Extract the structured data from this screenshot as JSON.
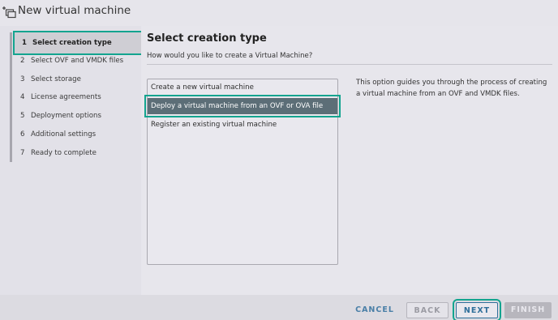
{
  "window": {
    "title": "New virtual machine",
    "icon": "new-vm-icon"
  },
  "sidebar": {
    "steps": [
      {
        "num": "1",
        "label": "Select creation type"
      },
      {
        "num": "2",
        "label": "Select OVF and VMDK files"
      },
      {
        "num": "3",
        "label": "Select storage"
      },
      {
        "num": "4",
        "label": "License agreements"
      },
      {
        "num": "5",
        "label": "Deployment options"
      },
      {
        "num": "6",
        "label": "Additional settings"
      },
      {
        "num": "7",
        "label": "Ready to complete"
      }
    ]
  },
  "main": {
    "heading": "Select creation type",
    "subheading": "How would you like to create a Virtual Machine?",
    "options": [
      {
        "label": "Create a new virtual machine"
      },
      {
        "label": "Deploy a virtual machine from an OVF or OVA file"
      },
      {
        "label": "Register an existing virtual machine"
      }
    ],
    "selected_option": "Deploy a virtual machine from an OVF or OVA file",
    "description": "This option guides you through the process of creating a virtual machine from an OVF and VMDK files."
  },
  "footer": {
    "cancel_label": "CANCEL",
    "back_label": "BACK",
    "next_label": "NEXT",
    "finish_label": "FINISH"
  },
  "colors": {
    "highlight": "#13a48f",
    "selected_option_bg": "#5c6e77",
    "primary_button": "#2f6f9a"
  }
}
